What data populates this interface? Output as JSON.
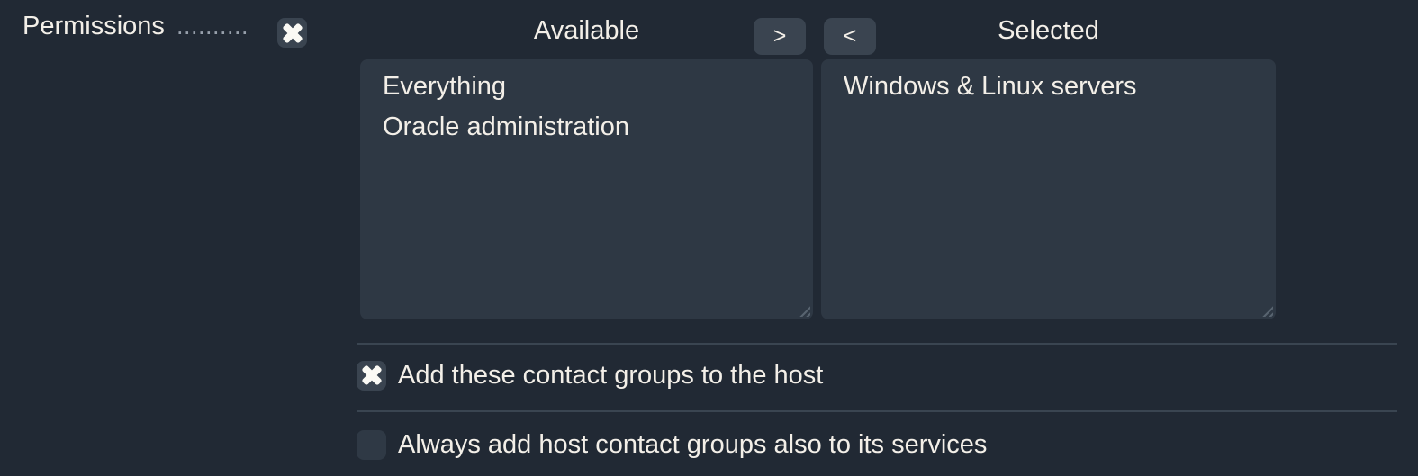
{
  "colors": {
    "background": "#212934",
    "panel": "#2e3844",
    "control": "#3a4450",
    "divider": "#3a4551",
    "text": "#f3efe8",
    "dots": "#97a0ab",
    "checkmark": "#fbfaf5"
  },
  "permissions_row": {
    "label": "Permissions",
    "dots": "..........",
    "checkbox_checked": true
  },
  "dual_list": {
    "available_header": "Available",
    "selected_header": "Selected",
    "move_to_selected_label": ">",
    "move_to_available_label": "<",
    "available_items": [
      "Everything",
      "Oracle administration"
    ],
    "selected_items": [
      "Windows & Linux servers"
    ]
  },
  "options": [
    {
      "label": "Add these contact groups to the host",
      "checked": true
    },
    {
      "label": "Always add host contact groups also to its services",
      "checked": false
    }
  ]
}
